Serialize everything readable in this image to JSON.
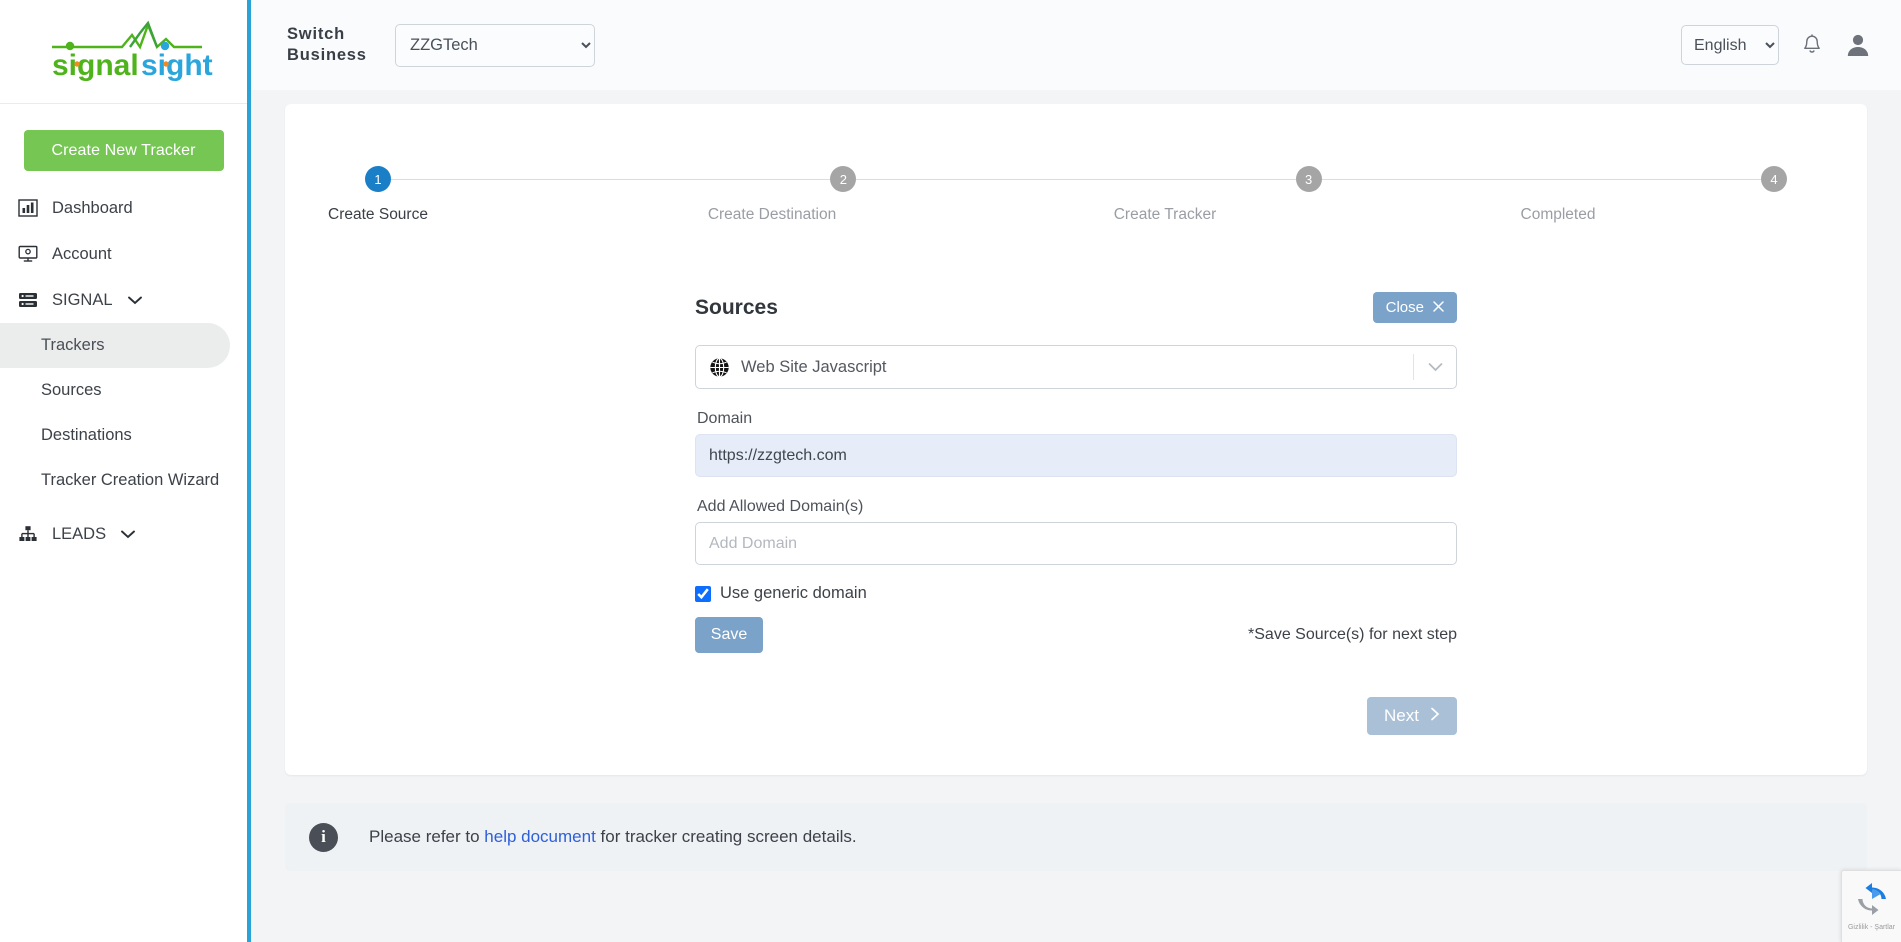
{
  "brand": {
    "name": "signalsight",
    "name_part1": "signal",
    "name_part2": "sight",
    "color_green": "#4fb31c",
    "color_blue": "#2ba6dd",
    "color_orange": "#f08a22"
  },
  "sidebar": {
    "create_button": "Create New Tracker",
    "items": [
      {
        "label": "Dashboard",
        "icon": "chart-bar-icon",
        "type": "link"
      },
      {
        "label": "Account",
        "icon": "monitor-icon",
        "type": "link"
      },
      {
        "label": "SIGNAL",
        "icon": "server-icon",
        "type": "group",
        "caret": "chevron-down-icon"
      },
      {
        "label": "Trackers",
        "type": "sub",
        "active": true
      },
      {
        "label": "Sources",
        "type": "sub",
        "active": false
      },
      {
        "label": "Destinations",
        "type": "sub",
        "active": false
      },
      {
        "label": "Tracker Creation Wizard",
        "type": "sub",
        "active": false
      },
      {
        "label": "LEADS",
        "icon": "sitemap-icon",
        "type": "group",
        "caret": "chevron-down-icon"
      }
    ]
  },
  "topbar": {
    "switch_business_label_line1": "Switch",
    "switch_business_label_line2": "Business",
    "business_selected": "ZZGTech",
    "business_options": [
      "ZZGTech"
    ],
    "language_selected": "English",
    "language_options": [
      "English"
    ],
    "bell_icon": "notification-bell-icon",
    "avatar_icon": "user-avatar-icon"
  },
  "stepper": {
    "current": 1,
    "steps": [
      {
        "number": "1",
        "label": "Create Source",
        "active": true
      },
      {
        "number": "2",
        "label": "Create Destination",
        "active": false
      },
      {
        "number": "3",
        "label": "Create Tracker",
        "active": false
      },
      {
        "number": "4",
        "label": "Completed",
        "active": false
      }
    ]
  },
  "form": {
    "title": "Sources",
    "close_label": "Close",
    "close_icon": "close-x-icon",
    "source_type": "Web Site Javascript",
    "source_type_icon": "globe-icon",
    "source_caret_icon": "chevron-down-icon",
    "domain_label": "Domain",
    "domain_value": "https://zzgtech.com",
    "allowed_domains_label": "Add Allowed Domain(s)",
    "allowed_domains_placeholder": "Add Domain",
    "allowed_domains_value": "",
    "generic_domain_label": "Use generic domain",
    "generic_domain_checked": true,
    "save_label": "Save",
    "save_note": "*Save Source(s) for next step",
    "next_label": "Next",
    "next_icon": "chevron-right-icon"
  },
  "info": {
    "icon": "info-circle-icon",
    "text_before": "Please refer to ",
    "link_text": "help document",
    "text_after": " for tracker creating screen details."
  },
  "recaptcha": {
    "icon": "recaptcha-icon",
    "text": "Gizlilik - Şartlar"
  }
}
